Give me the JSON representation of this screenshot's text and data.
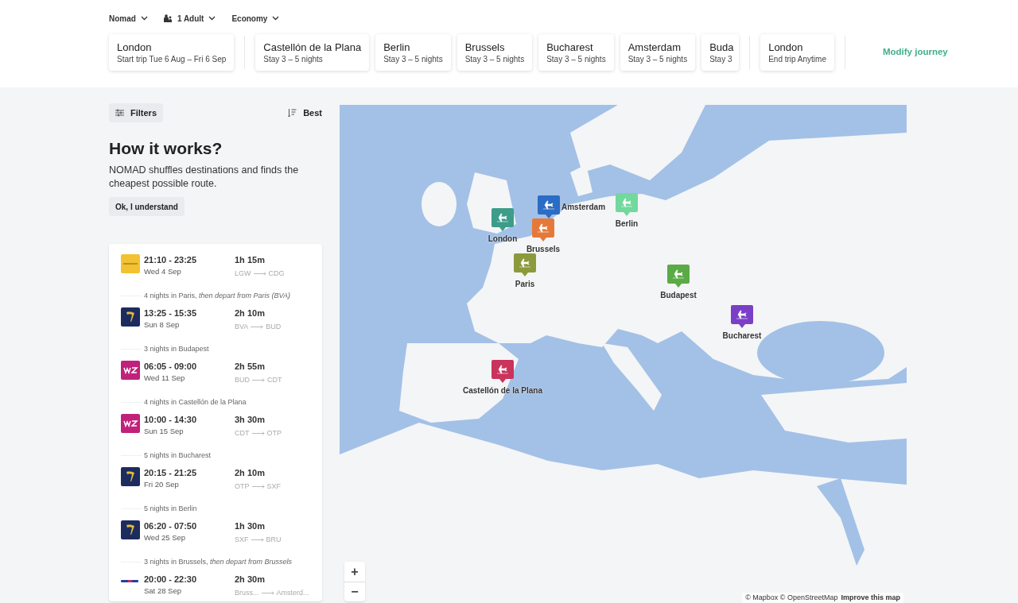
{
  "selectors": [
    {
      "label": "Nomad",
      "kind": "plain"
    },
    {
      "label": "1 Adult",
      "kind": "passengers"
    },
    {
      "label": "Economy",
      "kind": "plain"
    }
  ],
  "journey": [
    {
      "kind": "stop",
      "city": "London",
      "detail": "Start trip Tue 6 Aug – Fri 6 Sep"
    },
    {
      "kind": "divider"
    },
    {
      "kind": "stop",
      "city": "Castellón de la Plana",
      "detail": "Stay 3 – 5 nights"
    },
    {
      "kind": "stop",
      "city": "Berlin",
      "detail": "Stay 3 – 5 nights"
    },
    {
      "kind": "stop",
      "city": "Brussels",
      "detail": "Stay 3 – 5 nights"
    },
    {
      "kind": "stop",
      "city": "Bucharest",
      "detail": "Stay 3 – 5 nights"
    },
    {
      "kind": "stop",
      "city": "Amsterdam",
      "detail": "Stay 3 – 5 nights"
    },
    {
      "kind": "cut",
      "city": "Buda",
      "detail": "Stay 3"
    },
    {
      "kind": "divider"
    },
    {
      "kind": "stop",
      "city": "London",
      "detail": "End trip Anytime"
    },
    {
      "kind": "divider"
    }
  ],
  "modify_link": "Modify journey",
  "filters_button": "Filters",
  "sort_button": "Best",
  "intro": {
    "title": "How it works?",
    "text": "NOMAD shuffles destinations and finds the cheapest possible route.",
    "button": "Ok, I understand"
  },
  "itinerary": [
    {
      "kind": "flight",
      "logo": {
        "kind": "vueling"
      },
      "times": "21:10 - 23:25",
      "date": "Wed 4 Sep",
      "duration": "1h 15m",
      "from": "LGW",
      "to": "CDG"
    },
    {
      "kind": "stay",
      "text": "4 nights in Paris, *then depart from Paris (BVA)*"
    },
    {
      "kind": "flight",
      "logo": {
        "kind": "ryanair"
      },
      "times": "13:25 - 15:35",
      "date": "Sun 8 Sep",
      "duration": "2h 10m",
      "from": "BVA",
      "to": "BUD"
    },
    {
      "kind": "stay",
      "text": "3 nights in Budapest"
    },
    {
      "kind": "flight",
      "logo": {
        "kind": "wizz"
      },
      "times": "06:05 - 09:00",
      "date": "Wed 11 Sep",
      "duration": "2h 55m",
      "from": "BUD",
      "to": "CDT"
    },
    {
      "kind": "stay",
      "text": "4 nights in Castellón de la Plana"
    },
    {
      "kind": "flight",
      "logo": {
        "kind": "wizz"
      },
      "times": "10:00 - 14:30",
      "date": "Sun 15 Sep",
      "duration": "3h 30m",
      "from": "CDT",
      "to": "OTP"
    },
    {
      "kind": "stay",
      "text": "5 nights in Bucharest"
    },
    {
      "kind": "flight",
      "logo": {
        "kind": "ryanair"
      },
      "times": "20:15 - 21:25",
      "date": "Fri 20 Sep",
      "duration": "2h 10m",
      "from": "OTP",
      "to": "SXF"
    },
    {
      "kind": "stay",
      "text": "5 nights in Berlin"
    },
    {
      "kind": "flight",
      "logo": {
        "kind": "ryanair"
      },
      "times": "06:20 - 07:50",
      "date": "Wed 25 Sep",
      "duration": "1h 30m",
      "from": "SXF",
      "to": "BRU"
    },
    {
      "kind": "stay",
      "text": "3 nights in Brussels, *then depart from Brussels*"
    },
    {
      "kind": "flight",
      "logo": {
        "kind": "eurowings"
      },
      "times": "20:00 - 22:30",
      "date": "Sat 28 Sep",
      "duration": "2h 30m",
      "from": "Bruss...",
      "to": "Amsterd..."
    }
  ],
  "map": {
    "markers": [
      {
        "label": "London",
        "color": "#3d9c8a"
      },
      {
        "label": "Amsterdam",
        "color": "#2b6cc4"
      },
      {
        "label": "Berlin",
        "color": "#72d89c"
      },
      {
        "label": "Brussels",
        "color": "#e5793a"
      },
      {
        "label": "Paris",
        "color": "#8c9a3b"
      },
      {
        "label": "Budapest",
        "color": "#5aab45"
      },
      {
        "label": "Bucharest",
        "color": "#7a3fc6"
      },
      {
        "label": "Castellón de la Plana",
        "color": "#c9335c"
      }
    ],
    "zoom_in": "+",
    "zoom_out": "−",
    "attribution": "© Mapbox © OpenStreetMap",
    "improve_link": "Improve this map"
  }
}
